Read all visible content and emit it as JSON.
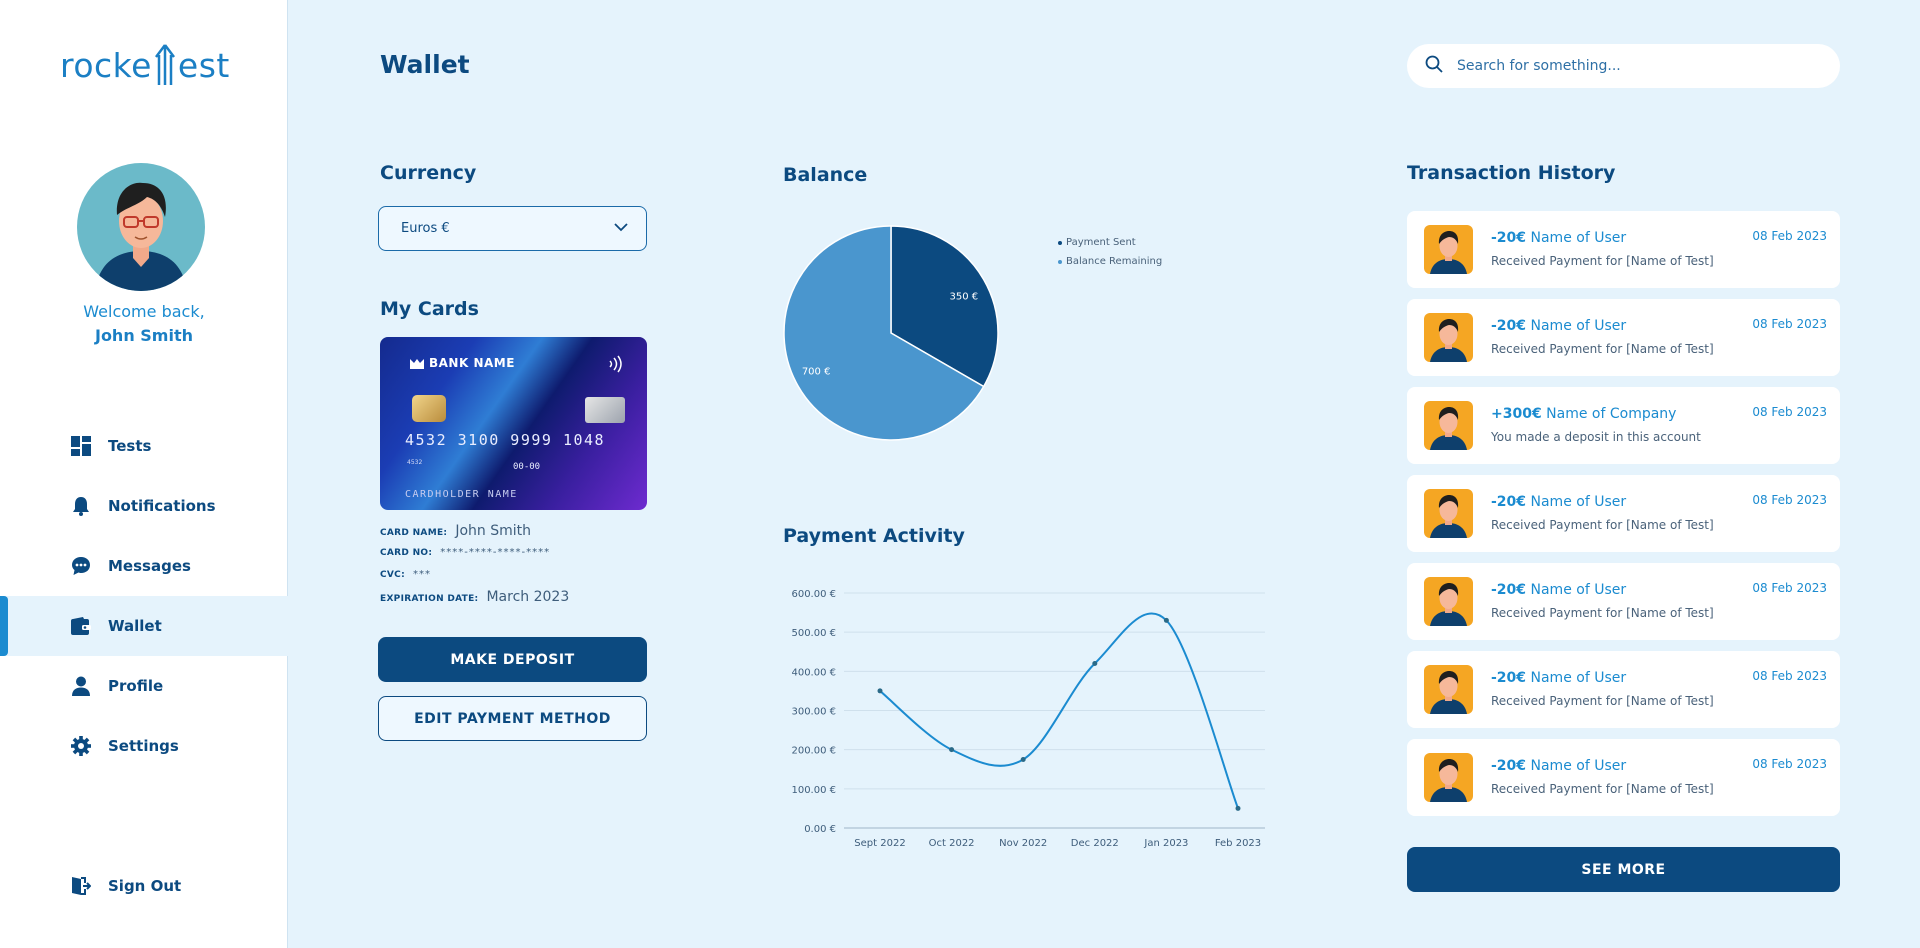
{
  "brand": {
    "logo_left": "rocke",
    "logo_right": "est"
  },
  "user": {
    "welcome": "Welcome back,",
    "name": "John Smith"
  },
  "sidebar": {
    "items": [
      {
        "label": "Tests",
        "icon": "dashboard-icon"
      },
      {
        "label": "Notifications",
        "icon": "bell-icon"
      },
      {
        "label": "Messages",
        "icon": "chat-icon"
      },
      {
        "label": "Wallet",
        "icon": "wallet-icon",
        "active": true
      },
      {
        "label": "Profile",
        "icon": "user-icon"
      },
      {
        "label": "Settings",
        "icon": "gear-icon"
      }
    ],
    "signout": {
      "label": "Sign Out",
      "icon": "signout-icon"
    }
  },
  "header": {
    "title": "Wallet",
    "search_placeholder": "Search for something..."
  },
  "currency": {
    "title": "Currency",
    "selected": "Euros €"
  },
  "cards": {
    "title": "My Cards",
    "card_image": {
      "bank": "BANK NAME",
      "number": "4532  3100  9999  1048",
      "small_number": "4532",
      "expiry": "00-00",
      "holder": "CARDHOLDER NAME"
    },
    "fields": {
      "name_label": "CARD NAME:",
      "name_value": "John Smith",
      "number_label": "CARD NO:",
      "number_value": "****-****-****-****",
      "cvc_label": "CVC:",
      "cvc_value": "***",
      "exp_label": "EXPIRATION DATE:",
      "exp_value": "March 2023"
    },
    "deposit_button": "MAKE DEPOSIT",
    "edit_button": "EDIT PAYMENT METHOD"
  },
  "balance": {
    "title": "Balance"
  },
  "activity": {
    "title": "Payment Activity"
  },
  "transactions": {
    "title": "Transaction History",
    "items": [
      {
        "amount": "-20€",
        "name": "Name of User",
        "desc": "Received Payment for [Name of Test]",
        "date": "08 Feb 2023"
      },
      {
        "amount": "-20€",
        "name": "Name of User",
        "desc": "Received Payment for [Name of Test]",
        "date": "08 Feb 2023"
      },
      {
        "amount": "+300€",
        "name": "Name of Company",
        "desc": "You made a deposit in this account",
        "date": "08 Feb 2023"
      },
      {
        "amount": "-20€",
        "name": "Name of User",
        "desc": "Received Payment for [Name of Test]",
        "date": "08 Feb 2023"
      },
      {
        "amount": "-20€",
        "name": "Name of User",
        "desc": "Received Payment for [Name of Test]",
        "date": "08 Feb 2023"
      },
      {
        "amount": "-20€",
        "name": "Name of User",
        "desc": "Received Payment for [Name of Test]",
        "date": "08 Feb 2023"
      },
      {
        "amount": "-20€",
        "name": "Name of User",
        "desc": "Received Payment for [Name of Test]",
        "date": "08 Feb 2023"
      }
    ],
    "see_more": "SEE MORE"
  },
  "colors": {
    "primary": "#0c4a80",
    "accent": "#1b8bd0",
    "background": "#e5f3fc",
    "pie_dark": "#0c4a80",
    "pie_light": "#4a96ce",
    "avatar_bg": "#f5a623"
  },
  "chart_data": [
    {
      "type": "pie",
      "title": "Balance",
      "labels": [
        "Payment Sent",
        "Balance Remaining"
      ],
      "values": [
        350,
        700
      ],
      "value_labels": [
        "350 €",
        "700 €"
      ],
      "legend_position": "right"
    },
    {
      "type": "line",
      "title": "Payment Activity",
      "categories": [
        "Sept 2022",
        "Oct 2022",
        "Nov 2022",
        "Dec 2022",
        "Jan 2023",
        "Feb 2023"
      ],
      "values": [
        350,
        200,
        175,
        420,
        530,
        50
      ],
      "ylim": [
        0,
        600
      ],
      "yticks": [
        "0.00 €",
        "100.00 €",
        "200.00 €",
        "300.00 €",
        "400.00 €",
        "500.00 €",
        "600.00 €"
      ],
      "grid": true
    }
  ]
}
